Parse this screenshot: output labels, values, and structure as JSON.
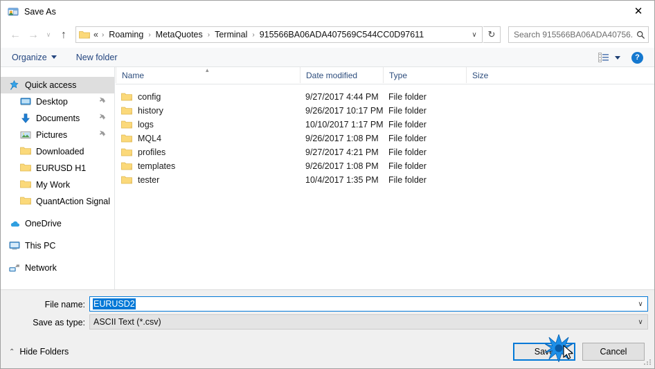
{
  "window": {
    "title": "Save As",
    "icon": "save-as-icon",
    "close_label": "✕"
  },
  "navigation": {
    "back": "←",
    "forward": "→",
    "recent": "∨",
    "up": "↑",
    "address": {
      "folder_icon": "folder-icon",
      "separator_first": "«",
      "crumbs": [
        "Roaming",
        "MetaQuotes",
        "Terminal",
        "915566BA06ADA407569C544CC0D97611"
      ],
      "chevron": "›",
      "dropdown": "∨"
    },
    "refresh": "↻",
    "search": {
      "placeholder": "Search 915566BA06ADA40756...",
      "icon": "search-icon"
    }
  },
  "toolbar": {
    "organize_label": "Organize",
    "new_folder_label": "New folder",
    "view_icon": "view-list-icon",
    "view_caret": "▾",
    "help_label": "?"
  },
  "sidebar": {
    "items": [
      {
        "label": "Quick access",
        "icon": "star-pin-icon",
        "level": 0,
        "selected": true,
        "pinned": false
      },
      {
        "label": "Desktop",
        "icon": "desktop-icon",
        "level": 1,
        "selected": false,
        "pinned": true
      },
      {
        "label": "Documents",
        "icon": "documents-download-icon",
        "level": 1,
        "selected": false,
        "pinned": true
      },
      {
        "label": "Pictures",
        "icon": "pictures-icon",
        "level": 1,
        "selected": false,
        "pinned": true
      },
      {
        "label": "Downloaded",
        "icon": "folder-icon",
        "level": 1,
        "selected": false,
        "pinned": false
      },
      {
        "label": "EURUSD H1",
        "icon": "folder-icon",
        "level": 1,
        "selected": false,
        "pinned": false
      },
      {
        "label": "My Work",
        "icon": "folder-icon",
        "level": 1,
        "selected": false,
        "pinned": false
      },
      {
        "label": "QuantAction Signal",
        "icon": "folder-icon",
        "level": 1,
        "selected": false,
        "pinned": false
      },
      {
        "label": "OneDrive",
        "icon": "onedrive-cloud-icon",
        "level": 0,
        "selected": false,
        "pinned": false,
        "gap_before": true
      },
      {
        "label": "This PC",
        "icon": "this-pc-icon",
        "level": 0,
        "selected": false,
        "pinned": false,
        "gap_before": true
      },
      {
        "label": "Network",
        "icon": "network-icon",
        "level": 0,
        "selected": false,
        "pinned": false,
        "gap_before": true
      }
    ]
  },
  "filelist": {
    "columns": [
      "Name",
      "Date modified",
      "Type",
      "Size"
    ],
    "sort_column": "Name",
    "sort_indicator": "▴",
    "rows": [
      {
        "name": "config",
        "date": "9/27/2017 4:44 PM",
        "type": "File folder",
        "size": ""
      },
      {
        "name": "history",
        "date": "9/26/2017 10:17 PM",
        "type": "File folder",
        "size": ""
      },
      {
        "name": "logs",
        "date": "10/10/2017 1:17 PM",
        "type": "File folder",
        "size": ""
      },
      {
        "name": "MQL4",
        "date": "9/26/2017 1:08 PM",
        "type": "File folder",
        "size": ""
      },
      {
        "name": "profiles",
        "date": "9/27/2017 4:21 PM",
        "type": "File folder",
        "size": ""
      },
      {
        "name": "templates",
        "date": "9/26/2017 1:08 PM",
        "type": "File folder",
        "size": ""
      },
      {
        "name": "tester",
        "date": "10/4/2017 1:35 PM",
        "type": "File folder",
        "size": ""
      }
    ]
  },
  "form": {
    "filename_label": "File name:",
    "filename_value": "EURUSD2",
    "filetype_label": "Save as type:",
    "filetype_value": "ASCII Text (*.csv)",
    "combo_chevron": "∨"
  },
  "footer": {
    "hide_folders_label": "Hide Folders",
    "hide_folders_caret": "⌃",
    "save_label": "Save",
    "cancel_label": "Cancel"
  },
  "colors": {
    "accent": "#0078d7",
    "selection": "#0078d7",
    "folder_yellow": "#fbd97a",
    "crumb_text": "#111111",
    "toolbar_link": "#23457f",
    "column_header": "#2d4d7d",
    "burst": "#1d8fe8"
  }
}
